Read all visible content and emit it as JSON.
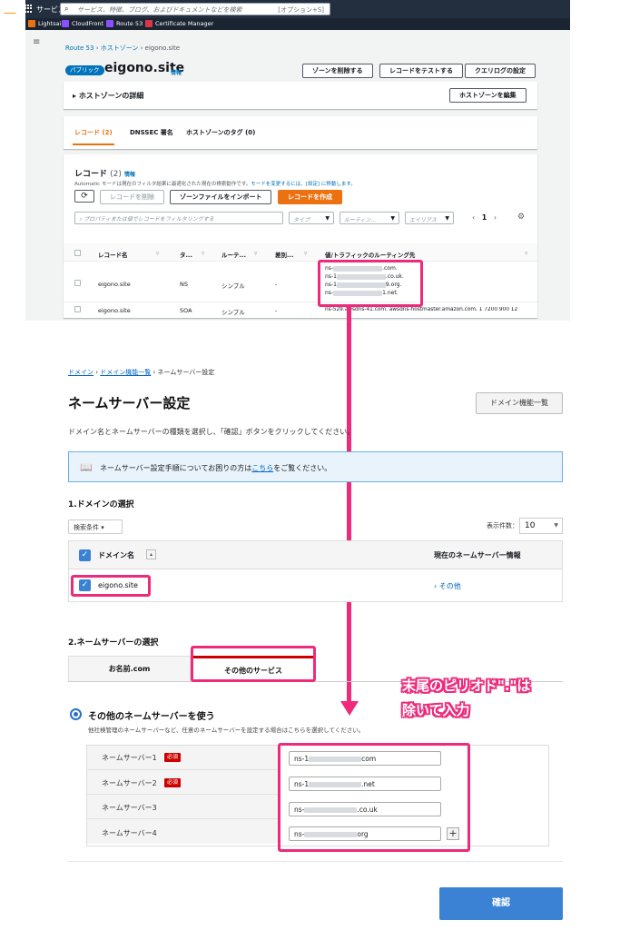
{
  "aws": {
    "logo": "aws",
    "services_label": "サービス",
    "search_placeholder": "サービス、特徴、ブログ、およびドキュメントなどを検索",
    "search_shortcut": "[オプション+S]",
    "favorites": [
      {
        "label": "Lightsail",
        "color": "#ec7211"
      },
      {
        "label": "CloudFront",
        "color": "#8c4fff"
      },
      {
        "label": "Route 53",
        "color": "#8c4fff"
      },
      {
        "label": "Certificate Manager",
        "color": "#dd344c"
      }
    ]
  },
  "route53": {
    "breadcrumb": [
      "Route 53",
      "ホストゾーン",
      "eigono.site"
    ],
    "badge": "パブリック",
    "zone_name": "eigono.site",
    "info": "情報",
    "buttons": {
      "delete_zone": "ゾーンを削除する",
      "test_record": "レコードをテストする",
      "query_log": "クエリログの設定"
    },
    "details_title": "ホストゾーンの詳細",
    "edit_zone": "ホストゾーンを編集",
    "tabs": [
      "レコード (2)",
      "DNSSEC 署名",
      "ホストゾーンのタグ (0)"
    ],
    "records_title": "レコード",
    "records_count": "(2)",
    "records_info": "情報",
    "records_desc_prefix": "Automatic モードは現在のフィルタ結果に最適化された現在の検索動作です。",
    "records_desc_link": "モードを変更するには、[設定] に移動します。",
    "actions": {
      "delete_record": "レコードを削除",
      "import_zone": "ゾーンファイルをインポート",
      "create_record": "レコードを作成"
    },
    "filter_placeholder": "プロパティまたは値でレコードをフィルタリングする",
    "filter_dropdowns": [
      "タイプ",
      "ルーティン...",
      "エイリアス"
    ],
    "page": "1",
    "columns": [
      "レコード名",
      "タ...",
      "ルーテ...",
      "差別...",
      "値/トラフィックのルーティング先"
    ],
    "rows": [
      {
        "name": "eigono.site",
        "type": "NS",
        "routing": "シンプル",
        "diff": "-",
        "values": [
          [
            "ns-",
            ".com."
          ],
          [
            "ns-1",
            ".co.uk."
          ],
          [
            "ns-1",
            "9.org."
          ],
          [
            "ns-",
            "1.net."
          ]
        ]
      },
      {
        "name": "eigono.site",
        "type": "SOA",
        "routing": "シンプル",
        "diff": "-",
        "value": "ns-529.awsdns-41.com. awsdns-hostmaster.amazon.com. 1 7200 900 12"
      }
    ]
  },
  "domain_page": {
    "breadcrumb": [
      "ドメイン",
      "ドメイン機能一覧",
      "ネームサーバー設定"
    ],
    "title": "ネームサーバー設定",
    "list_button": "ドメイン機能一覧",
    "description": "ドメイン名とネームサーバーの種類を選択し、「確認」ボタンをクリックしてください。",
    "info_prefix": "ネームサーバー設定手順についてお困りの方は",
    "info_link": "こちら",
    "info_suffix": "をご覧ください。",
    "section1": "1.ドメインの選択",
    "search_condition": "検索条件 ▾",
    "per_page_label": "表示件数：",
    "per_page_value": "10",
    "col_domain": "ドメイン名",
    "col_ns": "現在のネームサーバー情報",
    "domain": "eigono.site",
    "ns_current": "その他",
    "section2": "2.ネームサーバーの選択",
    "service_tabs": [
      "お名前.com",
      "その他のサービス"
    ],
    "callout": [
      "末尾のピリオド\".\"は",
      "除いて入力"
    ],
    "radio_title": "その他のネームサーバーを使う",
    "radio_desc": "他社検管理のネームサーバーなど、任意のネームサーバーを設定する場合はこちらを選択してください。",
    "required": "必須",
    "nameservers": [
      {
        "label": "ネームサーバー1",
        "required": true,
        "prefix": "ns-1",
        "suffix": "com"
      },
      {
        "label": "ネームサーバー2",
        "required": true,
        "prefix": "ns-1",
        "suffix": ".net"
      },
      {
        "label": "ネームサーバー3",
        "required": false,
        "prefix": "ns-",
        "suffix": ".co.uk"
      },
      {
        "label": "ネームサーバー4",
        "required": false,
        "prefix": "ns-",
        "suffix": "org"
      }
    ],
    "confirm": "確認"
  },
  "colors": {
    "highlight": "#ee2a7b",
    "aws_orange": "#ec7211",
    "brand_blue": "#3b82d4"
  }
}
